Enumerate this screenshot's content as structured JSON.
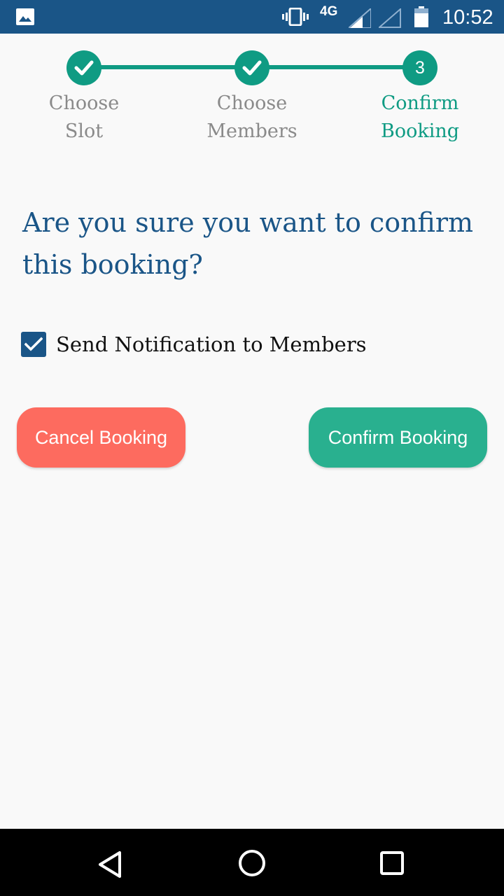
{
  "status_bar": {
    "network": "4G",
    "time": "10:52",
    "icons": [
      "image-icon",
      "vibrate-icon",
      "signal-icon",
      "signal-empty-icon",
      "battery-icon"
    ]
  },
  "stepper": {
    "steps": [
      {
        "label": "Choose\nSlot",
        "state": "completed"
      },
      {
        "label": "Choose\nMembers",
        "state": "completed"
      },
      {
        "label": "Confirm\nBooking",
        "state": "active",
        "number": "3"
      }
    ],
    "accent_color": "#0f9b83",
    "inactive_label_color": "#8a8a8a"
  },
  "main": {
    "question": "Are you sure you want to confirm this booking?",
    "notification_checkbox": {
      "label": "Send Notification to Members",
      "checked": true
    },
    "cancel_label": "Cancel Booking",
    "confirm_label": "Confirm Booking",
    "cancel_color": "#fd6b5f",
    "confirm_color": "#29b08f",
    "heading_color": "#1a5587"
  },
  "nav_bar": {
    "icons": [
      "back-icon",
      "home-icon",
      "recent-apps-icon"
    ]
  }
}
